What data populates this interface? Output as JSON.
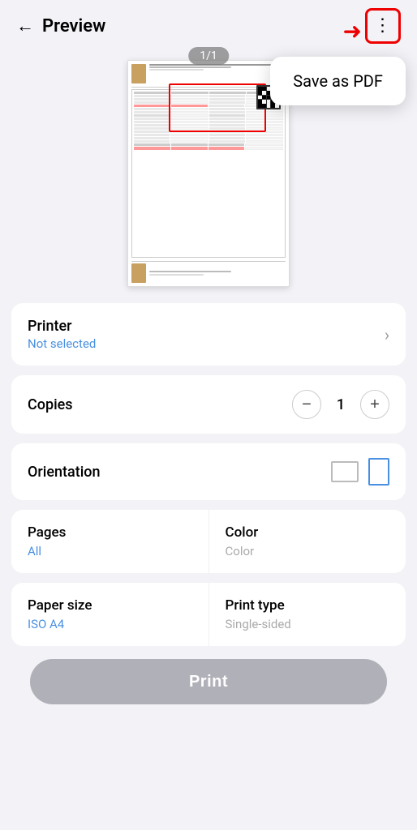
{
  "header": {
    "back_label": "←",
    "title": "Preview",
    "more_icon": "⋮"
  },
  "popup": {
    "label": "Save as PDF"
  },
  "preview": {
    "page_indicator": "1/1"
  },
  "settings": {
    "printer": {
      "label": "Printer",
      "value": "Not selected"
    },
    "copies": {
      "label": "Copies",
      "count": "1",
      "minus_label": "−",
      "plus_label": "+"
    },
    "orientation": {
      "label": "Orientation"
    },
    "pages": {
      "label": "Pages",
      "value": "All"
    },
    "color": {
      "label": "Color",
      "value": "Color"
    },
    "paper_size": {
      "label": "Paper size",
      "value": "ISO A4"
    },
    "print_type": {
      "label": "Print type",
      "value": "Single-sided"
    }
  },
  "footer": {
    "print_label": "Print"
  },
  "colors": {
    "accent": "#4a90e2",
    "red": "#dd0000",
    "button_gray": "#b0b0b8",
    "text_primary": "#000000",
    "text_secondary": "#aaaaaa"
  }
}
